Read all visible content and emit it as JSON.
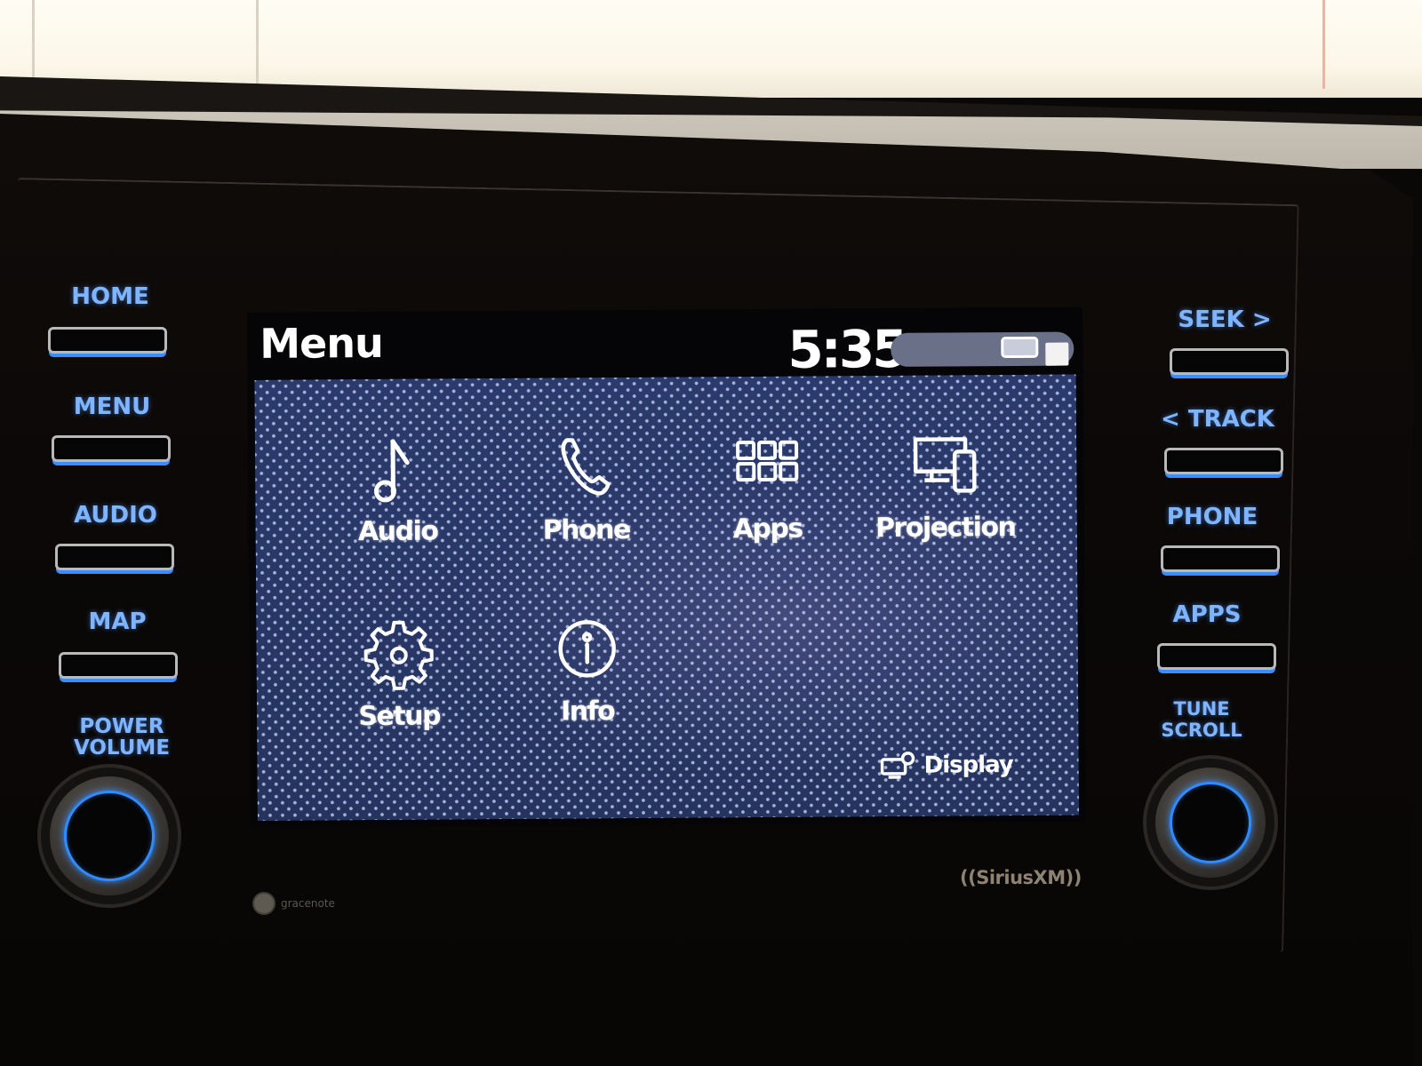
{
  "screen": {
    "title": "Menu",
    "clock": "5:35",
    "status_icons": [
      "connectivity-icon",
      "signal-icon"
    ],
    "menu_items": [
      {
        "label": "Audio",
        "icon": "music-note-icon"
      },
      {
        "label": "Phone",
        "icon": "phone-icon"
      },
      {
        "label": "Apps",
        "icon": "apps-grid-icon"
      },
      {
        "label": "Projection",
        "icon": "projection-icon"
      },
      {
        "label": "Setup",
        "icon": "gear-icon"
      },
      {
        "label": "Info",
        "icon": "info-icon"
      }
    ],
    "display_button": {
      "label": "Display",
      "icon": "display-settings-icon"
    }
  },
  "hardware": {
    "left_buttons": [
      "HOME",
      "MENU",
      "AUDIO",
      "MAP"
    ],
    "left_knob_label_line1": "POWER",
    "left_knob_label_line2": "VOLUME",
    "right_buttons": [
      "SEEK >",
      "< TRACK",
      "PHONE",
      "APPS"
    ],
    "right_knob_label_line1": "TUNE",
    "right_knob_label_line2": "SCROLL",
    "accent_color": "#3b8cff"
  },
  "logos": {
    "gracenote": "gracenote",
    "siriusxm": "((SiriusXM))"
  }
}
